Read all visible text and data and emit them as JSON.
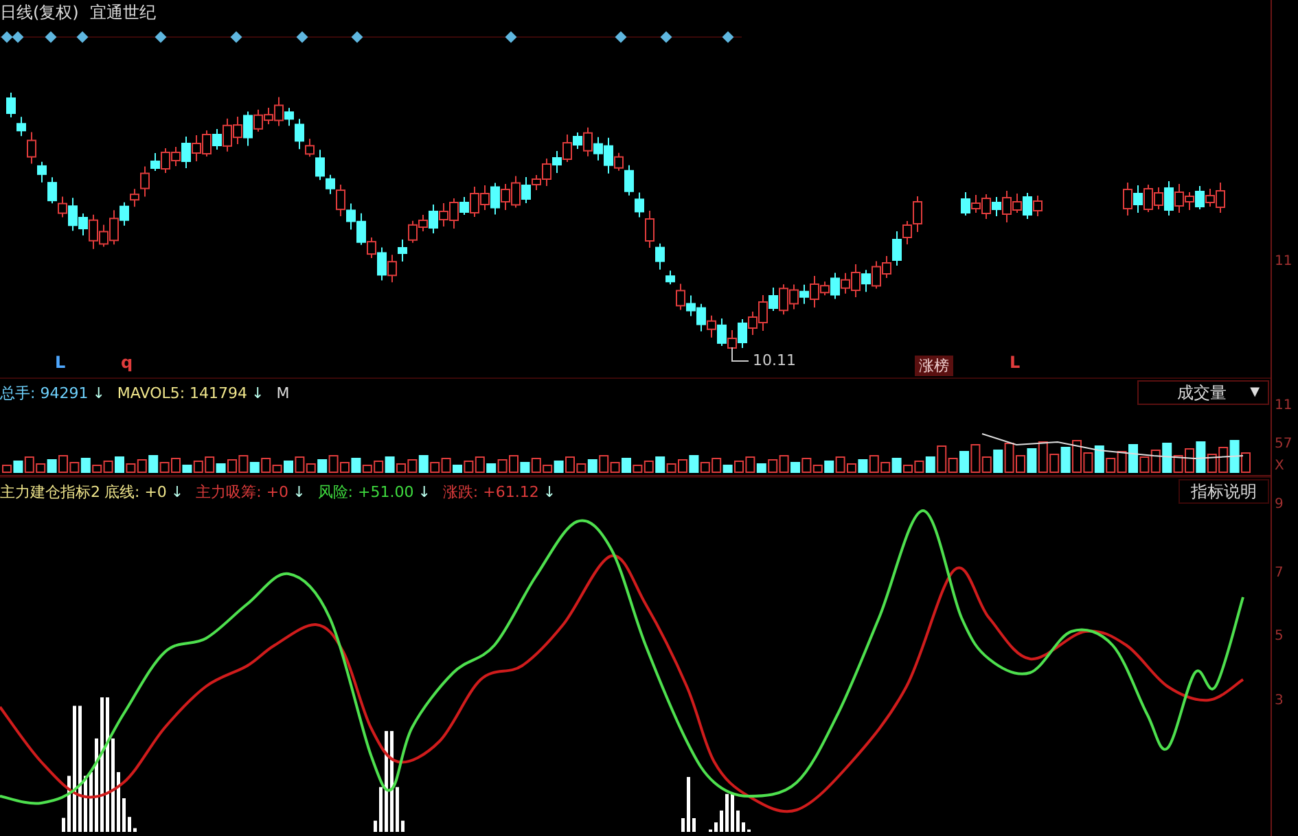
{
  "header": {
    "period": "日线(复权)",
    "stock_name": "宜通世纪"
  },
  "price_panel": {
    "signals": [
      {
        "text": "L",
        "color": "#4fa8ff"
      },
      {
        "text": "q",
        "color": "#e03c3c"
      },
      {
        "text": "L",
        "color": "#e03c3c"
      }
    ],
    "low_label": "10.11",
    "badge": "涨榜"
  },
  "axis_labels": [
    "11",
    "11",
    "57",
    "X",
    "9",
    "7",
    "5",
    "3"
  ],
  "volume_panel": {
    "legend": [
      {
        "label": "总手: 94291",
        "arrow": "↓",
        "color": "#6fd3ff"
      },
      {
        "label": "MAVOL5: 141794",
        "arrow": "↓",
        "color": "#f0e68c"
      },
      {
        "label": "M",
        "color": "#dddddd"
      }
    ],
    "selector": {
      "value": "成交量",
      "caret": "▼"
    }
  },
  "indicator_panel": {
    "name": "主力建仓指标2",
    "legend": [
      {
        "label": "底线: +0",
        "arrow": "↓",
        "color": "#f0e68c"
      },
      {
        "label": "主力吸筹: +0",
        "arrow": "↓",
        "color": "#e03c3c"
      },
      {
        "label": "风险: +51.00",
        "arrow": "↓",
        "color": "#3fdc3f"
      },
      {
        "label": "涨跌: +61.12",
        "arrow": "↓",
        "color": "#e03c3c"
      }
    ],
    "help_button": "指标说明"
  }
}
